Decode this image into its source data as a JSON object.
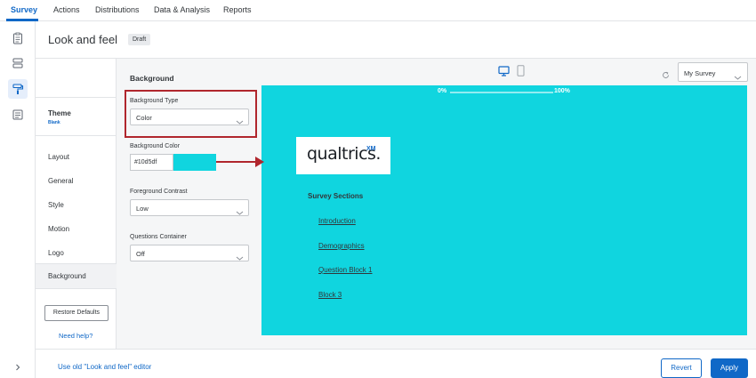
{
  "topnav": {
    "tabs": [
      {
        "label": "Survey",
        "active": true
      },
      {
        "label": "Actions",
        "active": false
      },
      {
        "label": "Distributions",
        "active": false
      },
      {
        "label": "Data & Analysis",
        "active": false
      },
      {
        "label": "Reports",
        "active": false
      }
    ]
  },
  "left_rail": {
    "icons": [
      "survey-flow-icon",
      "blocks-icon",
      "paint-roller-icon",
      "options-icon"
    ],
    "collapse_icon": "chevron-right-icon"
  },
  "header": {
    "title": "Look and feel",
    "badge": "Draft"
  },
  "sidebar": {
    "theme_title": "Theme",
    "theme_name": "Blank",
    "items": [
      "Layout",
      "General",
      "Style",
      "Motion",
      "Logo",
      "Background"
    ],
    "active_item": "Background",
    "restore_label": "Restore Defaults",
    "help_label": "Need help?"
  },
  "controls": {
    "section_title": "Background",
    "background_type": {
      "label": "Background Type",
      "value": "Color"
    },
    "background_color": {
      "label": "Background Color",
      "value": "#10d5df"
    },
    "foreground_contrast": {
      "label": "Foreground Contrast",
      "value": "Low"
    },
    "questions_container": {
      "label": "Questions Container",
      "value": "Off"
    }
  },
  "preview": {
    "device_icons": [
      "desktop-icon",
      "mobile-icon"
    ],
    "survey_select": "My Survey",
    "progress_start": "0%",
    "progress_end": "100%",
    "progress_fraction": 0,
    "logo_text": "qualtrics.",
    "logo_mark": "XM",
    "sections_title": "Survey Sections",
    "sections": [
      "Introduction",
      "Demographics",
      "Question Block 1",
      "Block 3"
    ],
    "background_color": "#10d5df"
  },
  "footer": {
    "old_editor_link": "Use old \"Look and feel\" editor",
    "revert_label": "Revert",
    "apply_label": "Apply"
  },
  "colors": {
    "accent": "#1068c7",
    "highlight_annotation": "#b0262d",
    "preview_background": "#10d5df"
  }
}
